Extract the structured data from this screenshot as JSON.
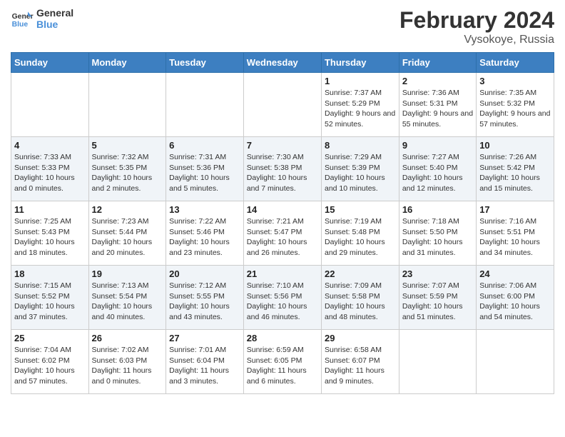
{
  "header": {
    "logo_line1": "General",
    "logo_line2": "Blue",
    "month_year": "February 2024",
    "location": "Vysokoye, Russia"
  },
  "weekdays": [
    "Sunday",
    "Monday",
    "Tuesday",
    "Wednesday",
    "Thursday",
    "Friday",
    "Saturday"
  ],
  "weeks": [
    [
      {
        "day": "",
        "info": ""
      },
      {
        "day": "",
        "info": ""
      },
      {
        "day": "",
        "info": ""
      },
      {
        "day": "",
        "info": ""
      },
      {
        "day": "1",
        "info": "Sunrise: 7:37 AM\nSunset: 5:29 PM\nDaylight: 9 hours and 52 minutes."
      },
      {
        "day": "2",
        "info": "Sunrise: 7:36 AM\nSunset: 5:31 PM\nDaylight: 9 hours and 55 minutes."
      },
      {
        "day": "3",
        "info": "Sunrise: 7:35 AM\nSunset: 5:32 PM\nDaylight: 9 hours and 57 minutes."
      }
    ],
    [
      {
        "day": "4",
        "info": "Sunrise: 7:33 AM\nSunset: 5:33 PM\nDaylight: 10 hours and 0 minutes."
      },
      {
        "day": "5",
        "info": "Sunrise: 7:32 AM\nSunset: 5:35 PM\nDaylight: 10 hours and 2 minutes."
      },
      {
        "day": "6",
        "info": "Sunrise: 7:31 AM\nSunset: 5:36 PM\nDaylight: 10 hours and 5 minutes."
      },
      {
        "day": "7",
        "info": "Sunrise: 7:30 AM\nSunset: 5:38 PM\nDaylight: 10 hours and 7 minutes."
      },
      {
        "day": "8",
        "info": "Sunrise: 7:29 AM\nSunset: 5:39 PM\nDaylight: 10 hours and 10 minutes."
      },
      {
        "day": "9",
        "info": "Sunrise: 7:27 AM\nSunset: 5:40 PM\nDaylight: 10 hours and 12 minutes."
      },
      {
        "day": "10",
        "info": "Sunrise: 7:26 AM\nSunset: 5:42 PM\nDaylight: 10 hours and 15 minutes."
      }
    ],
    [
      {
        "day": "11",
        "info": "Sunrise: 7:25 AM\nSunset: 5:43 PM\nDaylight: 10 hours and 18 minutes."
      },
      {
        "day": "12",
        "info": "Sunrise: 7:23 AM\nSunset: 5:44 PM\nDaylight: 10 hours and 20 minutes."
      },
      {
        "day": "13",
        "info": "Sunrise: 7:22 AM\nSunset: 5:46 PM\nDaylight: 10 hours and 23 minutes."
      },
      {
        "day": "14",
        "info": "Sunrise: 7:21 AM\nSunset: 5:47 PM\nDaylight: 10 hours and 26 minutes."
      },
      {
        "day": "15",
        "info": "Sunrise: 7:19 AM\nSunset: 5:48 PM\nDaylight: 10 hours and 29 minutes."
      },
      {
        "day": "16",
        "info": "Sunrise: 7:18 AM\nSunset: 5:50 PM\nDaylight: 10 hours and 31 minutes."
      },
      {
        "day": "17",
        "info": "Sunrise: 7:16 AM\nSunset: 5:51 PM\nDaylight: 10 hours and 34 minutes."
      }
    ],
    [
      {
        "day": "18",
        "info": "Sunrise: 7:15 AM\nSunset: 5:52 PM\nDaylight: 10 hours and 37 minutes."
      },
      {
        "day": "19",
        "info": "Sunrise: 7:13 AM\nSunset: 5:54 PM\nDaylight: 10 hours and 40 minutes."
      },
      {
        "day": "20",
        "info": "Sunrise: 7:12 AM\nSunset: 5:55 PM\nDaylight: 10 hours and 43 minutes."
      },
      {
        "day": "21",
        "info": "Sunrise: 7:10 AM\nSunset: 5:56 PM\nDaylight: 10 hours and 46 minutes."
      },
      {
        "day": "22",
        "info": "Sunrise: 7:09 AM\nSunset: 5:58 PM\nDaylight: 10 hours and 48 minutes."
      },
      {
        "day": "23",
        "info": "Sunrise: 7:07 AM\nSunset: 5:59 PM\nDaylight: 10 hours and 51 minutes."
      },
      {
        "day": "24",
        "info": "Sunrise: 7:06 AM\nSunset: 6:00 PM\nDaylight: 10 hours and 54 minutes."
      }
    ],
    [
      {
        "day": "25",
        "info": "Sunrise: 7:04 AM\nSunset: 6:02 PM\nDaylight: 10 hours and 57 minutes."
      },
      {
        "day": "26",
        "info": "Sunrise: 7:02 AM\nSunset: 6:03 PM\nDaylight: 11 hours and 0 minutes."
      },
      {
        "day": "27",
        "info": "Sunrise: 7:01 AM\nSunset: 6:04 PM\nDaylight: 11 hours and 3 minutes."
      },
      {
        "day": "28",
        "info": "Sunrise: 6:59 AM\nSunset: 6:05 PM\nDaylight: 11 hours and 6 minutes."
      },
      {
        "day": "29",
        "info": "Sunrise: 6:58 AM\nSunset: 6:07 PM\nDaylight: 11 hours and 9 minutes."
      },
      {
        "day": "",
        "info": ""
      },
      {
        "day": "",
        "info": ""
      }
    ]
  ]
}
